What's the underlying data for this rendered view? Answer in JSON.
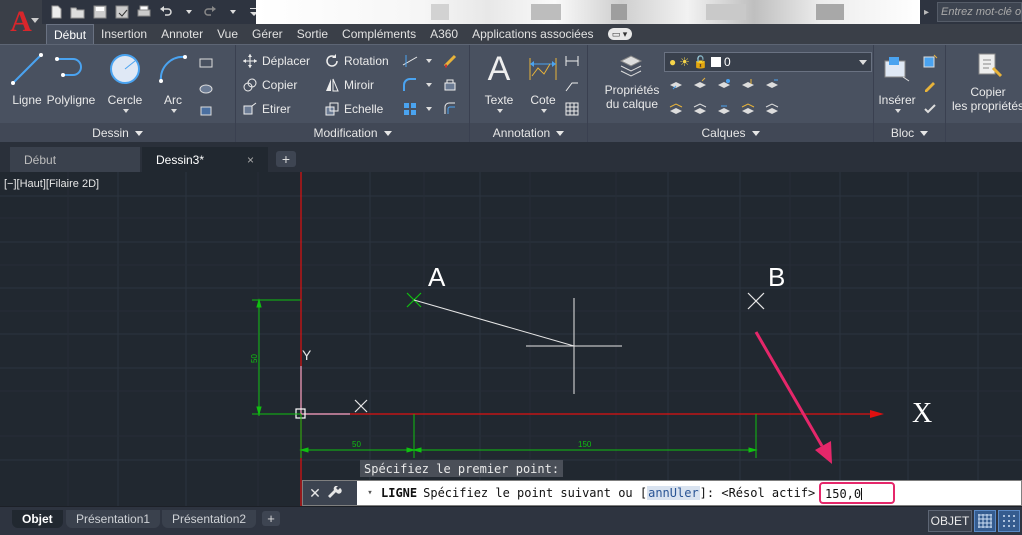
{
  "app": {
    "logo_letter": "A",
    "search_placeholder": "Entrez mot-clé ou"
  },
  "ribbon_tabs": [
    {
      "label": "Début",
      "active": true
    },
    {
      "label": "Insertion"
    },
    {
      "label": "Annoter"
    },
    {
      "label": "Vue"
    },
    {
      "label": "Gérer"
    },
    {
      "label": "Sortie"
    },
    {
      "label": "Compléments"
    },
    {
      "label": "A360"
    },
    {
      "label": "Applications associées"
    }
  ],
  "panels": {
    "dessin": {
      "title": "Dessin",
      "tools": {
        "ligne": "Ligne",
        "polyligne": "Polyligne",
        "cercle": "Cercle",
        "arc": "Arc"
      }
    },
    "modification": {
      "title": "Modification",
      "tools": {
        "deplacer": "Déplacer",
        "rotation": "Rotation",
        "copier": "Copier",
        "miroir": "Miroir",
        "etirer": "Etirer",
        "echelle": "Echelle"
      }
    },
    "annotation": {
      "title": "Annotation",
      "tools": {
        "texte": "Texte",
        "cote": "Cote"
      }
    },
    "calques": {
      "title": "Calques",
      "proprietes_line1": "Propriétés",
      "proprietes_line2": "du calque",
      "current_layer": "0"
    },
    "bloc": {
      "title": "Bloc",
      "inserer": "Insérer"
    },
    "copier_proprietes": {
      "line1": "Copier",
      "line2": "les propriétés"
    }
  },
  "doc_tabs": [
    {
      "label": "Début"
    },
    {
      "label": "Dessin3*",
      "active": true,
      "close": "×"
    }
  ],
  "doc_tab_add": "+",
  "viewport": {
    "label": "[−][Haut][Filaire 2D]",
    "point_a": "A",
    "point_b": "B",
    "axis_x": "X",
    "axis_y": "Y",
    "dim_vertical": "50",
    "dim_horizontal_1": "50",
    "dim_horizontal_2": "150",
    "tooltip": "Spécifiez le premier point:"
  },
  "command_line": {
    "close": "✕",
    "command": "LIGNE",
    "prompt_before": "Spécifiez le point suivant ou [",
    "option": "annUler",
    "prompt_after": "]:  <Résol actif>",
    "input_value": "150,0"
  },
  "layout_tabs": [
    {
      "label": "Objet",
      "active": true
    },
    {
      "label": "Présentation1"
    },
    {
      "label": "Présentation2"
    }
  ],
  "layout_tab_add": "+",
  "status": {
    "model_space": "OBJET"
  },
  "colors": {
    "canvas": "#212830",
    "x_axis": "#e01010",
    "y_axis": "#e01010",
    "dimension": "#10c010",
    "highlight": "#e5276a"
  }
}
